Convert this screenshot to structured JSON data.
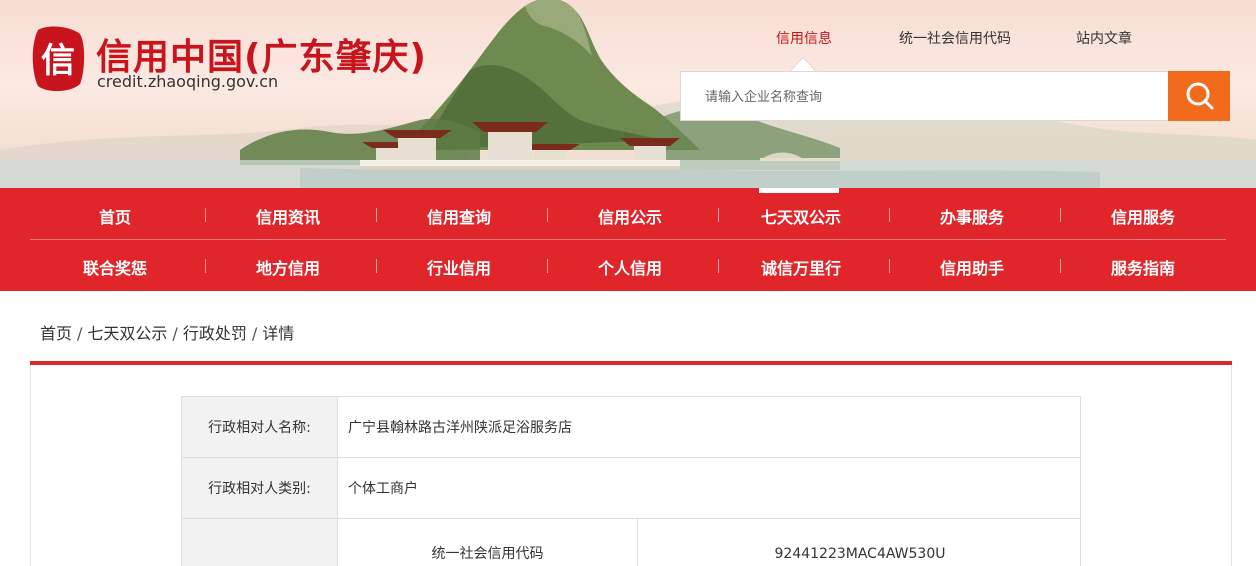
{
  "site": {
    "seal_char": "信",
    "title": "信用中国(广东肇庆)",
    "url": "credit.zhaoqing.gov.cn"
  },
  "topnav": {
    "items": [
      {
        "label": "信用信息",
        "active": true
      },
      {
        "label": "统一社会信用代码",
        "active": false
      },
      {
        "label": "站内文章",
        "active": false
      }
    ]
  },
  "search": {
    "placeholder": "请输入企业名称查询",
    "button_icon": "search-icon"
  },
  "mainnav": {
    "rows": [
      [
        "首页",
        "信用资讯",
        "信用查询",
        "信用公示",
        "七天双公示",
        "办事服务",
        "信用服务"
      ],
      [
        "联合奖惩",
        "地方信用",
        "行业信用",
        "个人信用",
        "诚信万里行",
        "信用助手",
        "服务指南"
      ]
    ],
    "active": "七天双公示"
  },
  "breadcrumb": {
    "items": [
      "首页",
      "七天双公示",
      "行政处罚",
      "详情"
    ],
    "separator": "/"
  },
  "detail": {
    "rows": [
      {
        "label": "行政相对人名称:",
        "value": "广宁县翰林路古洋州陕派足浴服务店"
      },
      {
        "label": "行政相对人类别:",
        "value": "个体工商户"
      }
    ],
    "sub_row": {
      "sub_label": "统一社会信用代码",
      "sub_value": "92441223MAC4AW530U"
    }
  },
  "colors": {
    "brand_red": "#e0262a",
    "title_red": "#c8141c",
    "search_orange": "#f26b1d"
  }
}
